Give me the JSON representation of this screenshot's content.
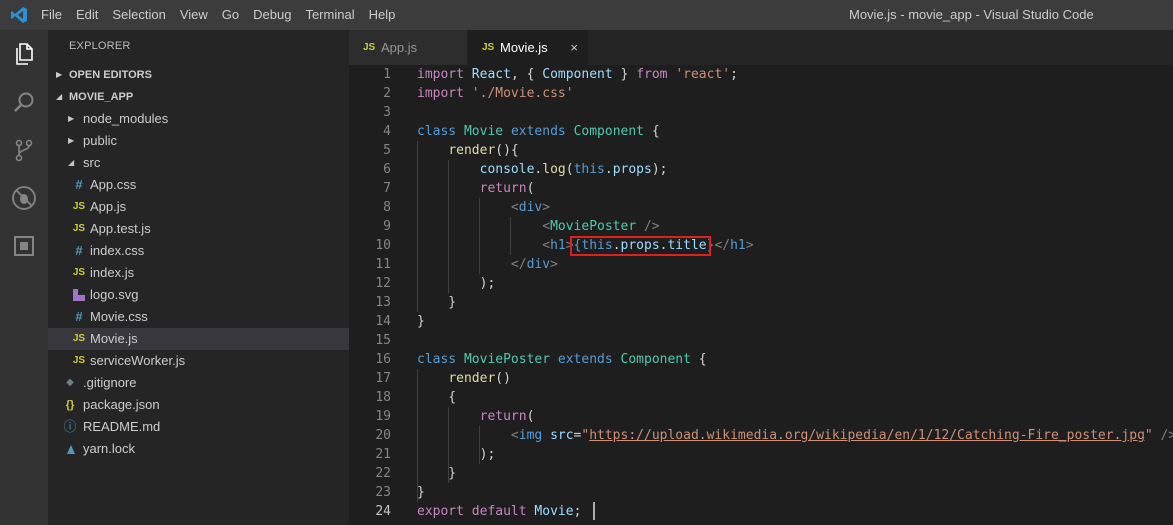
{
  "titlebar": {
    "menu": [
      "File",
      "Edit",
      "Selection",
      "View",
      "Go",
      "Debug",
      "Terminal",
      "Help"
    ],
    "window_title": "Movie.js - movie_app - Visual Studio Code"
  },
  "activity_bar": {
    "icons": [
      "explorer-icon",
      "search-icon",
      "source-control-icon",
      "debug-icon",
      "extensions-icon"
    ]
  },
  "sidebar": {
    "header": "EXPLORER",
    "open_editors": "OPEN EDITORS",
    "project": "MOVIE_APP",
    "tree": [
      {
        "name": "node_modules",
        "kind": "folder",
        "expanded": false
      },
      {
        "name": "public",
        "kind": "folder",
        "expanded": false
      },
      {
        "name": "src",
        "kind": "folder",
        "expanded": true
      },
      {
        "name": "App.css",
        "kind": "css",
        "icon": "#"
      },
      {
        "name": "App.js",
        "kind": "js",
        "icon": "JS"
      },
      {
        "name": "App.test.js",
        "kind": "js",
        "icon": "JS"
      },
      {
        "name": "index.css",
        "kind": "css",
        "icon": "#"
      },
      {
        "name": "index.js",
        "kind": "js",
        "icon": "JS"
      },
      {
        "name": "logo.svg",
        "kind": "svg",
        "icon": ""
      },
      {
        "name": "Movie.css",
        "kind": "css",
        "icon": "#"
      },
      {
        "name": "Movie.js",
        "kind": "js",
        "icon": "JS",
        "selected": true
      },
      {
        "name": "serviceWorker.js",
        "kind": "js",
        "icon": "JS"
      },
      {
        "name": ".gitignore",
        "kind": "git",
        "icon": "◆"
      },
      {
        "name": "package.json",
        "kind": "json",
        "icon": "{}"
      },
      {
        "name": "README.md",
        "kind": "info",
        "icon": "ⓘ"
      },
      {
        "name": "yarn.lock",
        "kind": "yarn",
        "icon": ""
      }
    ]
  },
  "tabs": [
    {
      "label": "App.js",
      "badge": "JS",
      "active": false
    },
    {
      "label": "Movie.js",
      "badge": "JS",
      "active": true,
      "close": "×"
    }
  ],
  "editor": {
    "current_line": 24,
    "lines": [
      "import React, { Component } from 'react';",
      "import './Movie.css'",
      "",
      "class Movie extends Component {",
      "    render(){",
      "        console.log(this.props);",
      "        return(",
      "            <div>",
      "                <MoviePoster />",
      "                <h1>{this.props.title}</h1>",
      "            </div>",
      "        );",
      "    }",
      "}",
      "",
      "class MoviePoster extends Component {",
      "    render()",
      "    {",
      "        return(",
      "            <img src=\"https://upload.wikimedia.org/wikipedia/en/1/12/Catching-Fire_poster.jpg\" />",
      "        );",
      "    }",
      "}",
      "export default Movie;"
    ]
  },
  "colors": {
    "keyword": "#569cd6",
    "type": "#4ec9b0",
    "string": "#ce9178",
    "function": "#dcdcaa",
    "variable": "#9cdcfe",
    "control": "#c586c0",
    "highlight_border": "#e02020",
    "js_badge": "#cbcb41",
    "css_badge": "#519aba"
  }
}
